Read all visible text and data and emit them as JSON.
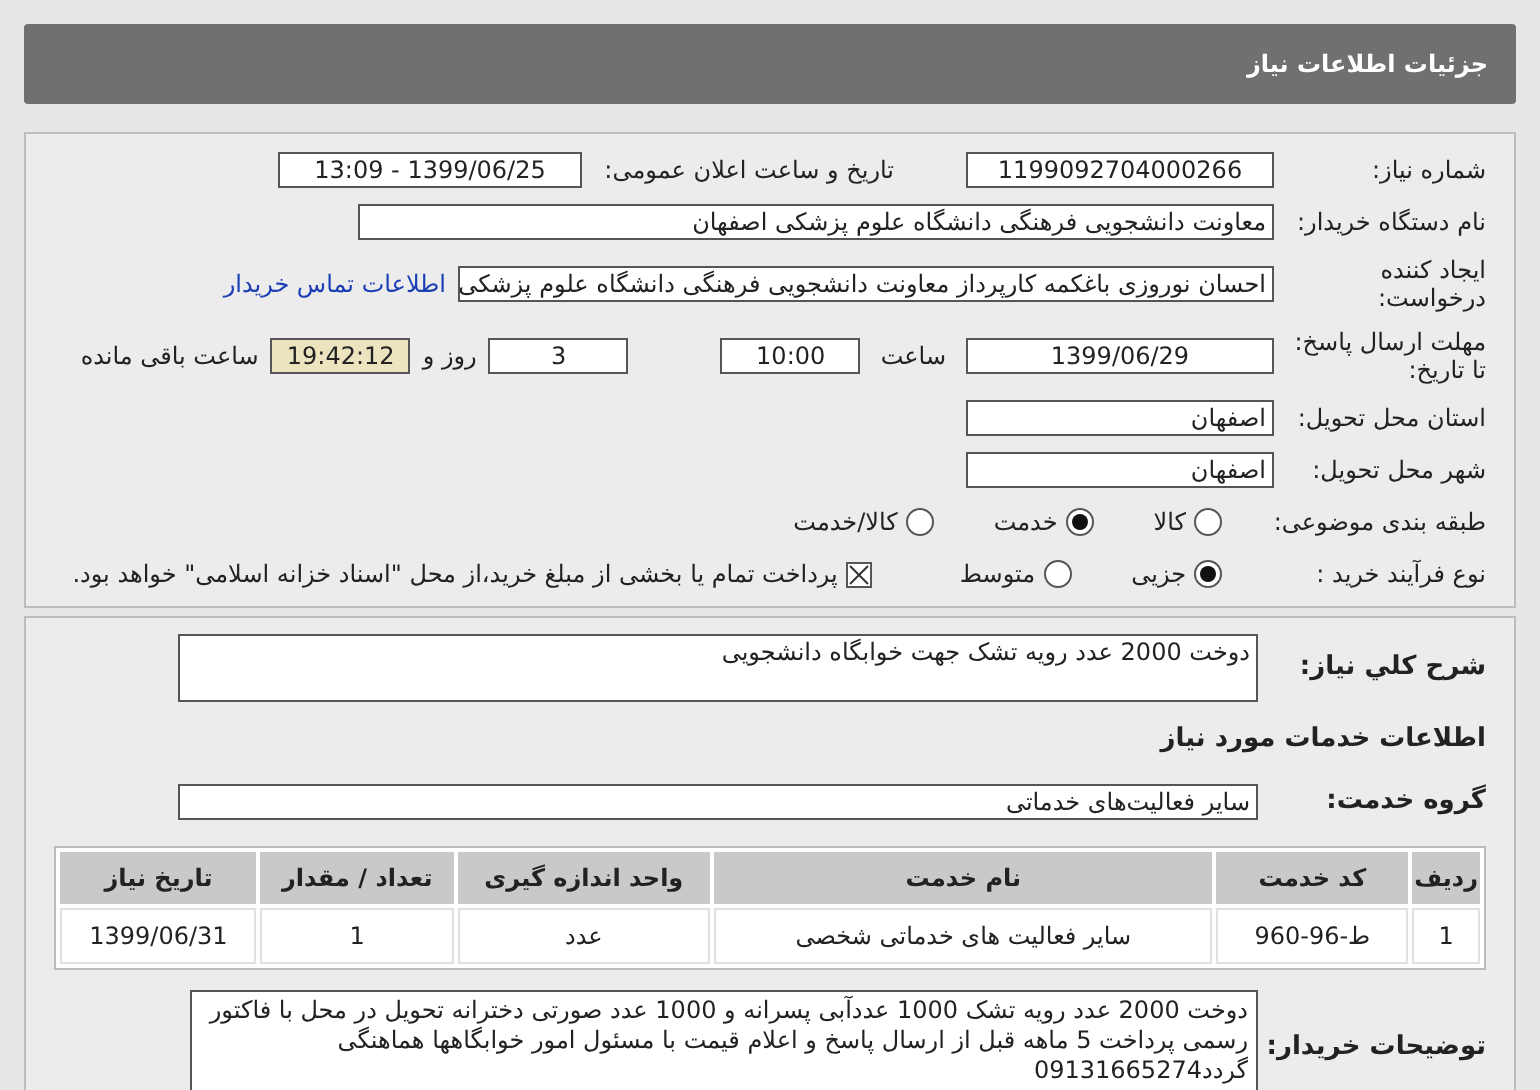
{
  "header": {
    "title": "جزئیات اطلاعات نیاز"
  },
  "need_number": {
    "label": "شماره نیاز:",
    "value": "1199092704000266"
  },
  "announce": {
    "label": "تاریخ و ساعت اعلان عمومی:",
    "value": "1399/06/25 - 13:09"
  },
  "buyer_org": {
    "label": "نام دستگاه خریدار:",
    "value": "معاونت دانشجویی فرهنگی دانشگاه علوم پزشکی اصفهان"
  },
  "requester": {
    "label": "ایجاد کننده درخواست:",
    "value": "احسان نوروزی باغکمه کارپرداز معاونت دانشجویی فرهنگی دانشگاه علوم پزشکی",
    "link": "اطلاعات تماس خریدار"
  },
  "deadline": {
    "label": "مهلت ارسال پاسخ: تا تاریخ:",
    "date": "1399/06/29",
    "time_label": "ساعت",
    "time": "10:00",
    "days": "3",
    "days_label": "روز و",
    "remaining": "19:42:12",
    "remaining_label": "ساعت باقی مانده"
  },
  "province": {
    "label": "استان محل تحویل:",
    "value": "اصفهان"
  },
  "city": {
    "label": "شهر محل تحویل:",
    "value": "اصفهان"
  },
  "category": {
    "label": "طبقه بندی موضوعی:",
    "options": [
      {
        "label": "کالا",
        "selected": false
      },
      {
        "label": "خدمت",
        "selected": true
      },
      {
        "label": "کالا/خدمت",
        "selected": false
      }
    ]
  },
  "process": {
    "label": "نوع فرآیند خرید :",
    "options": [
      {
        "label": "جزیی",
        "selected": true
      },
      {
        "label": "متوسط",
        "selected": false
      }
    ],
    "payment": {
      "label": "پرداخت تمام یا بخشی از مبلغ خرید،از محل \"اسناد خزانه اسلامی\" خواهد بود.",
      "checked": true
    }
  },
  "summary": {
    "label": "شرح كلي نياز:",
    "value": "دوخت 2000 عدد رویه تشک جهت خوابگاه دانشجویی"
  },
  "services_heading": "اطلاعات خدمات مورد نیاز",
  "service_group": {
    "label": "گروه خدمت:",
    "value": "سایر فعالیت‌های خدماتی"
  },
  "table": {
    "columns": [
      "ردیف",
      "کد خدمت",
      "نام خدمت",
      "واحد اندازه گیری",
      "تعداد / مقدار",
      "تاریخ نیاز"
    ],
    "rows": [
      [
        "1",
        "ط-96-960",
        "سایر فعالیت های خدماتی شخصی",
        "عدد",
        "1",
        "1399/06/31"
      ]
    ]
  },
  "buyer_notes": {
    "label": "توضیحات خریدار:",
    "value": "دوخت 2000 عدد رویه تشک 1000 عددآبی پسرانه و 1000 عدد صورتی دخترانه تحویل در محل با فاکتور رسمی پرداخت 5 ماهه قبل از ارسال پاسخ و اعلام قیمت با مسئول امور خوابگاهها هماهنگی گردد09131665274"
  }
}
